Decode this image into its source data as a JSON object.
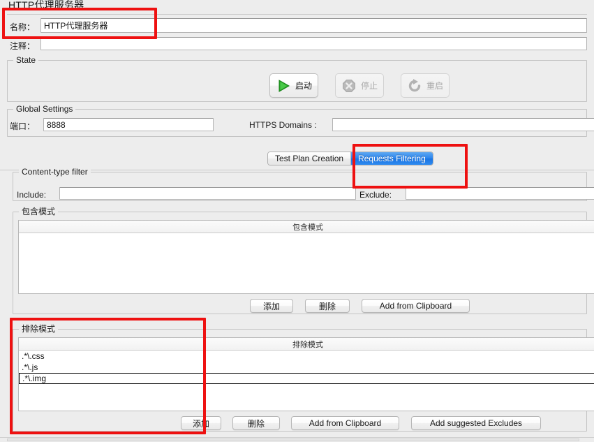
{
  "window": {
    "panel_title": "HTTP代理服务器"
  },
  "header": {
    "name_label": "名称：",
    "name_value": "HTTP代理服务器",
    "comment_label": "注释：",
    "comment_value": ""
  },
  "state": {
    "group_label": "State",
    "buttons": [
      {
        "label": "启动",
        "icon": "play-icon",
        "enabled": true
      },
      {
        "label": "停止",
        "icon": "stop-icon",
        "enabled": false
      },
      {
        "label": "重启",
        "icon": "restart-icon",
        "enabled": false
      }
    ]
  },
  "global_settings": {
    "group_label": "Global Settings",
    "port_label": "端口：",
    "port_value": "8888",
    "https_domains_label": "HTTPS Domains :",
    "https_domains_value": ""
  },
  "tabs": {
    "items": [
      {
        "label": "Test Plan Creation",
        "active": false
      },
      {
        "label": "Requests Filtering",
        "active": true
      }
    ]
  },
  "content_type_filter": {
    "group_label": "Content-type filter",
    "include_label": "Include:",
    "include_value": "",
    "exclude_label": "Exclude:",
    "exclude_value": ""
  },
  "include_patterns": {
    "group_label": "包含模式",
    "column_header": "包含模式",
    "rows": [],
    "buttons": [
      {
        "label": "添加"
      },
      {
        "label": "删除"
      },
      {
        "label": "Add from Clipboard"
      }
    ]
  },
  "exclude_patterns": {
    "group_label": "排除模式",
    "column_header": "排除模式",
    "rows": [
      {
        "value": ".*\\.css",
        "editing": false
      },
      {
        "value": ".*\\.js",
        "editing": false
      },
      {
        "value": ".*\\.img",
        "editing": true
      }
    ],
    "buttons": [
      {
        "label": "添加"
      },
      {
        "label": "删除"
      },
      {
        "label": "Add from Clipboard"
      },
      {
        "label": "Add suggested Excludes"
      }
    ]
  },
  "annotations": {
    "color": "#ee1111",
    "boxes": [
      {
        "name": "name-field-highlight"
      },
      {
        "name": "requests-filtering-tab-highlight"
      },
      {
        "name": "exclude-patterns-highlight"
      }
    ]
  }
}
